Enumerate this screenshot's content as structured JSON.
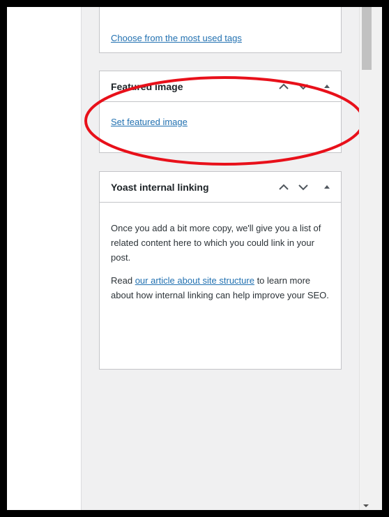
{
  "tags_box": {
    "link": "Choose from the most used tags"
  },
  "featured_box": {
    "title": "Featured image",
    "link": "Set featured image"
  },
  "yoast_box": {
    "title": "Yoast internal linking",
    "paragraph1": "Once you add a bit more copy, we'll give you a list of related content here to which you could link in your post.",
    "p2_prefix": "Read ",
    "p2_link": "our article about site structure",
    "p2_suffix": " to learn more about how internal linking can help improve your SEO."
  },
  "annotation": {
    "color": "#e8101a"
  },
  "icons": [
    "chevron-up-icon",
    "chevron-down-icon",
    "toggle-panel-icon"
  ]
}
